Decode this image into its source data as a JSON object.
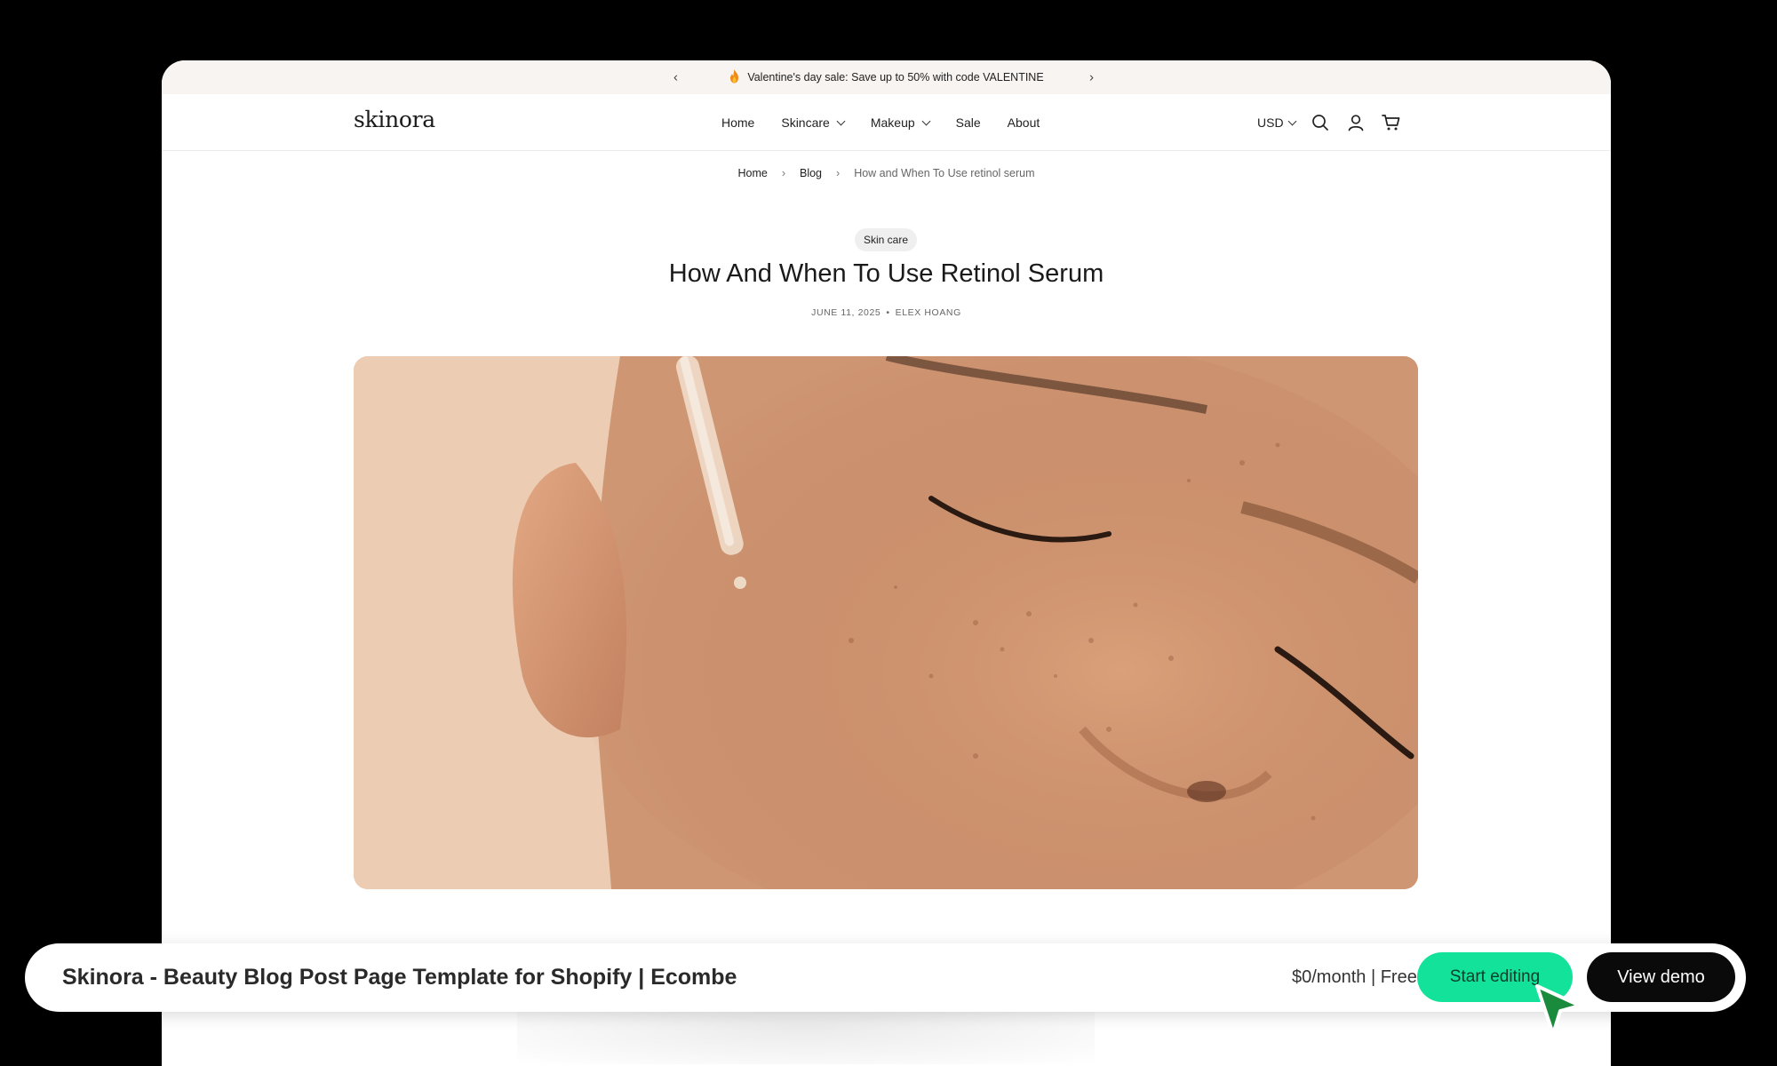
{
  "announcement": {
    "prev_arrow": "‹",
    "next_arrow": "›",
    "icon": "fire-icon",
    "text": "Valentine's day sale: Save up to 50% with code VALENTINE"
  },
  "header": {
    "logo": "skinora",
    "nav": [
      {
        "label": "Home",
        "dropdown": false
      },
      {
        "label": "Skincare",
        "dropdown": true
      },
      {
        "label": "Makeup",
        "dropdown": true
      },
      {
        "label": "Sale",
        "dropdown": false
      },
      {
        "label": "About",
        "dropdown": false
      }
    ],
    "currency": "USD",
    "icons": [
      "search-icon",
      "account-icon",
      "cart-icon"
    ]
  },
  "breadcrumb": {
    "items": [
      "Home",
      "Blog",
      "How and When To Use retinol serum"
    ],
    "separator": "›"
  },
  "article": {
    "tag": "Skin care",
    "title": "How And When To Use Retinol Serum",
    "date": "JUNE 11, 2025",
    "meta_separator": "•",
    "author": "ELEX HOANG"
  },
  "bottom_bar": {
    "title": "Skinora - Beauty Blog Post Page Template for Shopify | Ecombe",
    "price": "$0/month | Free",
    "start_label": "Start editing",
    "demo_label": "View demo"
  },
  "colors": {
    "accent_green": "#12e29a",
    "announce_bg": "#f8f4f1",
    "dark_button": "#0a0a0a"
  }
}
